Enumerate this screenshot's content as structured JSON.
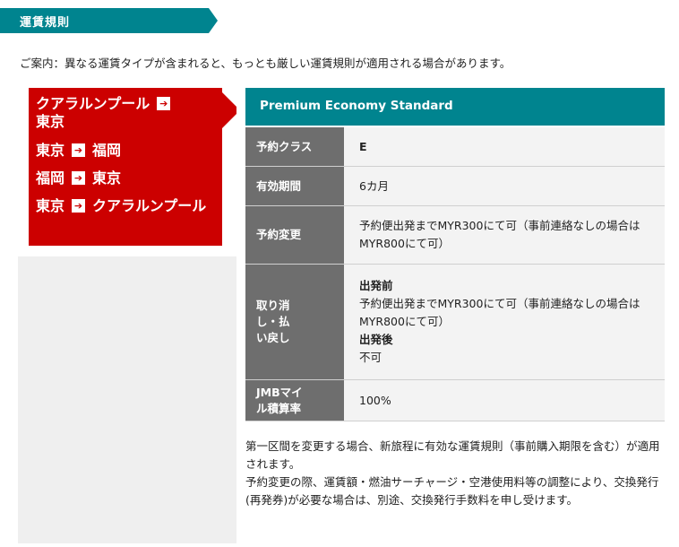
{
  "section": {
    "title": "運賃規則"
  },
  "notice": "ご案内：異なる運賃タイプが含まれると、もっとも厳しい運賃規則が適用される場合があります。",
  "routes": [
    {
      "from": "クアラルンプール",
      "to": "東京"
    },
    {
      "from": "東京",
      "to": "福岡"
    },
    {
      "from": "福岡",
      "to": "東京"
    },
    {
      "from": "東京",
      "to": "クアラルンプール"
    }
  ],
  "fare": {
    "name": "Premium Economy Standard",
    "rows": [
      {
        "label": "予約クラス",
        "value": "E"
      },
      {
        "label": "有効期間",
        "value": "6カ月"
      },
      {
        "label": "予約変更",
        "value": "予約便出発までMYR300にて可（事前連絡なしの場合はMYR800にて可）"
      },
      {
        "label": "取り消し・払い戻し",
        "before_label": "出発前",
        "before_value": "予約便出発までMYR300にて可（事前連絡なしの場合はMYR800にて可）",
        "after_label": "出発後",
        "after_value": "不可"
      },
      {
        "label": "JMBマイル積算率",
        "value": "100%"
      }
    ]
  },
  "footnotes": [
    "第一区間を変更する場合、新旅程に有効な運賃規則（事前購入期限を含む）が適用されます。",
    "予約変更の際、運賃額・燃油サーチャージ・空港使用料等の調整により、交換発行(再発券)が必要な場合は、別途、交換発行手数料を申し受けます。"
  ],
  "colors": {
    "teal": "#00848f",
    "red": "#cc0000",
    "label_gray": "#6e6e6e"
  }
}
